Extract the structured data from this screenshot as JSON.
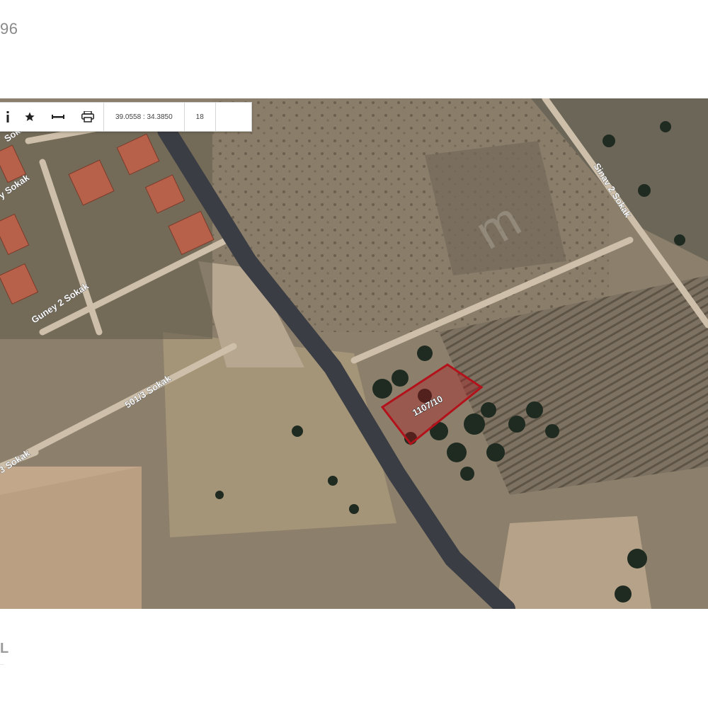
{
  "header": {
    "partial_text": "96"
  },
  "toolbar": {
    "icons": [
      "info-icon",
      "star-icon",
      "measure-icon",
      "print-icon"
    ],
    "coordinates": "39.0558 : 34.3850",
    "zoom": "18"
  },
  "map": {
    "parcel_label": "1107/10",
    "parcel_color": "#b3121b",
    "streets": {
      "left_partial": "Sokak",
      "left_mid_partial": "y Sokak",
      "guney": "Guney 2 Sokak",
      "s5013": "501/3 Sokak",
      "bottom_left_partial": "3 Sokak",
      "right_upper": "Sinav 2 Sokak"
    },
    "watermark": "m"
  },
  "footer": {
    "logo_partial": "L",
    "logo_sub": "..."
  }
}
